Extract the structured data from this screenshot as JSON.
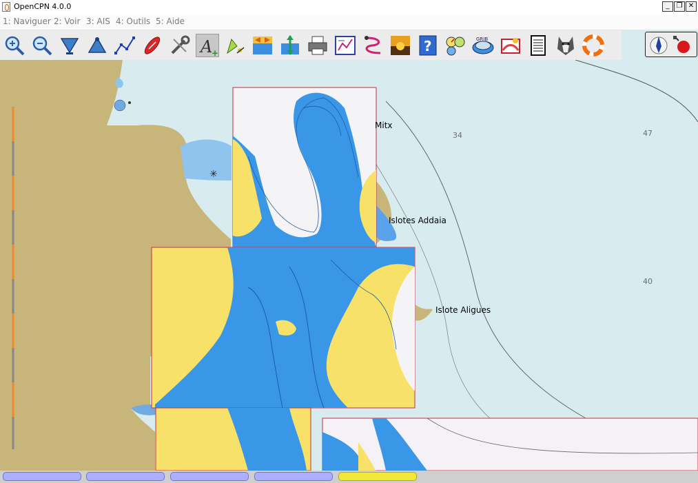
{
  "window": {
    "title": "OpenCPN 4.0.0",
    "minimize": "_",
    "restore": "❐",
    "close": "✕"
  },
  "menu": [
    "1: Naviguer",
    "2: Voir",
    "3: AIS",
    "4: Outils",
    "5: Aide"
  ],
  "toolbar": {
    "tools": [
      {
        "name": "zoom-in-icon"
      },
      {
        "name": "zoom-out-icon"
      },
      {
        "name": "scale-down-icon"
      },
      {
        "name": "scale-up-icon"
      },
      {
        "name": "route-icon"
      },
      {
        "name": "auto-follow-icon"
      },
      {
        "name": "settings-icon"
      },
      {
        "name": "text-icon",
        "pressed": true
      },
      {
        "name": "quilt-icon"
      },
      {
        "name": "current-icon"
      },
      {
        "name": "tide-icon"
      },
      {
        "name": "print-icon"
      },
      {
        "name": "route-manager-icon"
      },
      {
        "name": "track-icon"
      },
      {
        "name": "color-scheme-icon"
      },
      {
        "name": "help-icon"
      },
      {
        "name": "dashboard-icon"
      },
      {
        "name": "grib-icon"
      },
      {
        "name": "chart-downloader-icon"
      },
      {
        "name": "logbook-icon"
      },
      {
        "name": "husky-icon"
      },
      {
        "name": "mob-icon"
      }
    ]
  },
  "chart": {
    "place_labels": [
      "Mitx",
      "Islotes Addaia",
      "Islote Aligues"
    ],
    "soundings": [
      "34",
      "47",
      "40"
    ],
    "colors": {
      "sea": "#d8ecf0",
      "land": "#c8b57a",
      "shallow": "#2f8fe6",
      "inset_land": "#f8e168",
      "inset_border": "#c0304a"
    }
  },
  "statusbar": {
    "piano_keys": [
      {
        "active": false
      },
      {
        "active": false
      },
      {
        "active": false
      },
      {
        "active": false
      },
      {
        "active": true
      }
    ]
  }
}
